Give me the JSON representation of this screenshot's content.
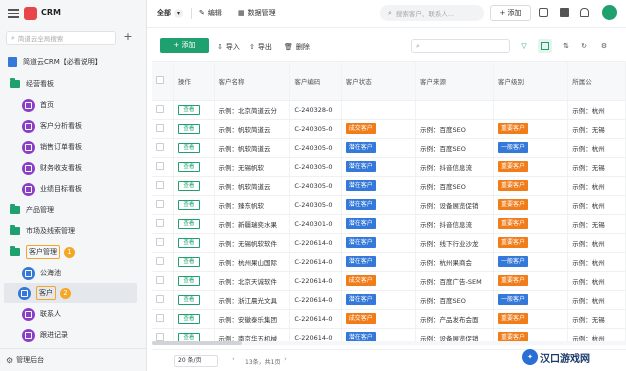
{
  "app": {
    "name": "CRM",
    "search_placeholder": "简道云全局搜索"
  },
  "sidebar": {
    "root": "简道云CRM【必看说明】",
    "groups": [
      {
        "label": "经营看板",
        "items": [
          "首页",
          "客户分析看板",
          "销售订单看板",
          "财务收支看板",
          "业绩目标看板"
        ]
      },
      {
        "label": "产品管理"
      },
      {
        "label": "市场及线索管理"
      },
      {
        "label": "客户管理",
        "badge": "1",
        "items": [
          "公海池",
          "客户",
          "联系人",
          "跟进记录"
        ],
        "active_badge": "2"
      }
    ],
    "footer": "管理后台"
  },
  "topbar": {
    "view_select": "全部",
    "edit": "编辑",
    "data_manage": "数据管理",
    "search_placeholder": "搜索客户、联系人...",
    "add": "+ 添加"
  },
  "toolbar": {
    "add": "+ 添加",
    "import": "导入",
    "export": "导出",
    "delete": "删除"
  },
  "table": {
    "headers": [
      "",
      "操作",
      "客户名称",
      "客户编码",
      "客户状态",
      "客户来源",
      "客户级别",
      "所属公"
    ],
    "view_label": "查看",
    "rows": [
      {
        "name": "示例：北京简道云分",
        "code": "C-240328-0",
        "status": "",
        "status_color": "",
        "source": "",
        "level": "",
        "level_color": "",
        "region": "示例：杭州"
      },
      {
        "name": "示例：帆软简道云",
        "code": "C-240305-0",
        "status": "成交客户",
        "status_color": "#f07c1a",
        "source": "示例：百度SEO",
        "level": "重要客户",
        "level_color": "#f07c1a",
        "region": "示例：无锡"
      },
      {
        "name": "示例：帆软简道云",
        "code": "C-240305-0",
        "status": "潜在客户",
        "status_color": "#3478d9",
        "source": "示例：百度SEO",
        "level": "一般客户",
        "level_color": "#3478d9",
        "region": "示例：杭州"
      },
      {
        "name": "示例：无锡帆软",
        "code": "C-240305-0",
        "status": "潜在客户",
        "status_color": "#3478d9",
        "source": "示例：抖音信息流",
        "level": "重要客户",
        "level_color": "#f07c1a",
        "region": "示例：无锡"
      },
      {
        "name": "示例：帆软简道云",
        "code": "C-240305-0",
        "status": "潜在客户",
        "status_color": "#3478d9",
        "source": "示例：百度SEO",
        "level": "重要客户",
        "level_color": "#f07c1a",
        "region": "示例：杭州"
      },
      {
        "name": "示例：臻东帆软",
        "code": "C-240305-0",
        "status": "潜在客户",
        "status_color": "#3478d9",
        "source": "示例：设备展览促销",
        "level": "重要客户",
        "level_color": "#f07c1a",
        "region": "示例：杭州"
      },
      {
        "name": "示例：新疆瑞奕水果",
        "code": "C-240301-0",
        "status": "潜在客户",
        "status_color": "#3478d9",
        "source": "示例：抖音信息流",
        "level": "重要客户",
        "level_color": "#f07c1a",
        "region": "示例：无锡"
      },
      {
        "name": "示例：无锡帆软软件",
        "code": "C-220614-0",
        "status": "潜在客户",
        "status_color": "#3478d9",
        "source": "示例：线下行业沙龙",
        "level": "重要客户",
        "level_color": "#f07c1a",
        "region": "示例：杭州"
      },
      {
        "name": "示例：杭州果山国际",
        "code": "C-220614-0",
        "status": "潜在客户",
        "status_color": "#3478d9",
        "source": "示例：杭州果商会",
        "level": "一般客户",
        "level_color": "#3478d9",
        "region": "示例：杭州"
      },
      {
        "name": "示例：北京天诚软件",
        "code": "C-220614-0",
        "status": "成交客户",
        "status_color": "#f07c1a",
        "source": "示例：百度广告-SEM",
        "level": "重要客户",
        "level_color": "#f07c1a",
        "region": "示例：杭州"
      },
      {
        "name": "示例：浙江晨光文具",
        "code": "C-220614-0",
        "status": "潜在客户",
        "status_color": "#3478d9",
        "source": "示例：百度SEO",
        "level": "一般客户",
        "level_color": "#3478d9",
        "region": "示例：杭州"
      },
      {
        "name": "示例：安徽泰乐集团",
        "code": "C-220614-0",
        "status": "成交客户",
        "status_color": "#f07c1a",
        "source": "示例：产品发布会面",
        "level": "重要客户",
        "level_color": "#f07c1a",
        "region": "示例：无锡"
      },
      {
        "name": "示例：南京华五机械",
        "code": "C-220614-0",
        "status": "潜在客户",
        "status_color": "#3478d9",
        "source": "示例：设备展览促销",
        "level": "重要客户",
        "level_color": "#f07c1a",
        "region": "示例：杭州"
      }
    ]
  },
  "pagination": {
    "page_size": "20 条/页",
    "summary": "13条，共1页"
  },
  "watermark": "汉口游戏网"
}
